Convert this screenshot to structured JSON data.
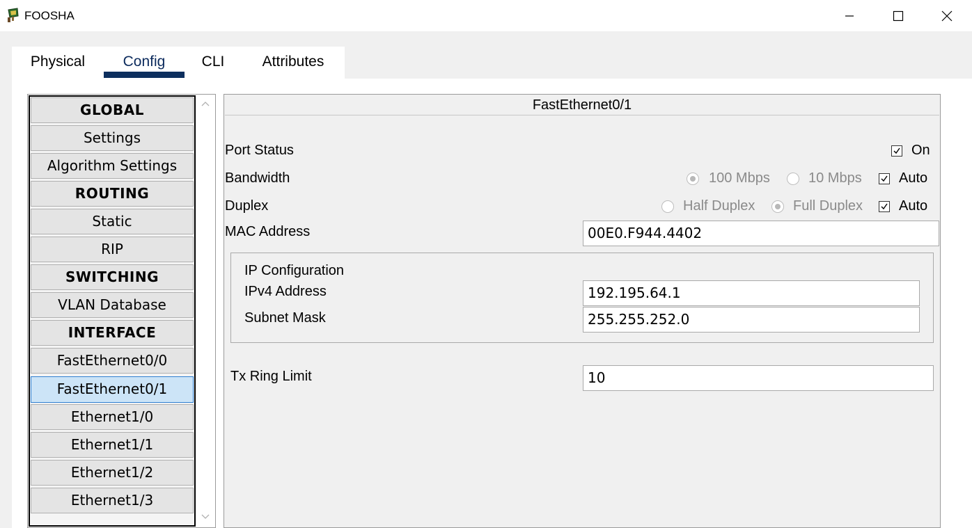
{
  "window": {
    "title": "FOOSHA",
    "app_icon": "packet-tracer-router-icon",
    "controls": [
      "minimize-icon",
      "maximize-icon",
      "close-icon"
    ]
  },
  "tabs": [
    {
      "label": "Physical",
      "active": false
    },
    {
      "label": "Config",
      "active": true
    },
    {
      "label": "CLI",
      "active": false
    },
    {
      "label": "Attributes",
      "active": false
    }
  ],
  "sidebar": {
    "items": [
      {
        "label": "GLOBAL",
        "type": "header"
      },
      {
        "label": "Settings",
        "type": "item"
      },
      {
        "label": "Algorithm Settings",
        "type": "item"
      },
      {
        "label": "ROUTING",
        "type": "header"
      },
      {
        "label": "Static",
        "type": "item"
      },
      {
        "label": "RIP",
        "type": "item"
      },
      {
        "label": "SWITCHING",
        "type": "header"
      },
      {
        "label": "VLAN Database",
        "type": "item"
      },
      {
        "label": "INTERFACE",
        "type": "header"
      },
      {
        "label": "FastEthernet0/0",
        "type": "item"
      },
      {
        "label": "FastEthernet0/1",
        "type": "item",
        "selected": true
      },
      {
        "label": "Ethernet1/0",
        "type": "item"
      },
      {
        "label": "Ethernet1/1",
        "type": "item"
      },
      {
        "label": "Ethernet1/2",
        "type": "item"
      },
      {
        "label": "Ethernet1/3",
        "type": "item"
      }
    ]
  },
  "interface": {
    "title": "FastEthernet0/1",
    "port_status": {
      "label": "Port Status",
      "on_label": "On",
      "on_checked": true
    },
    "bandwidth": {
      "label": "Bandwidth",
      "option_100": "100 Mbps",
      "option_100_checked": true,
      "option_10": "10 Mbps",
      "option_10_checked": false,
      "auto_label": "Auto",
      "auto_checked": true
    },
    "duplex": {
      "label": "Duplex",
      "half": "Half Duplex",
      "half_checked": false,
      "full": "Full Duplex",
      "full_checked": true,
      "auto_label": "Auto",
      "auto_checked": true
    },
    "mac": {
      "label": "MAC Address",
      "value": "00E0.F944.4402"
    },
    "ip_config": {
      "title": "IP Configuration",
      "ipv4_label": "IPv4 Address",
      "ipv4_value": "192.195.64.1",
      "mask_label": "Subnet Mask",
      "mask_value": "255.255.252.0"
    },
    "tx_ring": {
      "label": "Tx Ring Limit",
      "value": "10"
    }
  },
  "colors": {
    "active_tab_underline": "#0d2f5e",
    "selected_item_bg": "#cce4f7",
    "selected_item_border": "#2f7fd0"
  }
}
